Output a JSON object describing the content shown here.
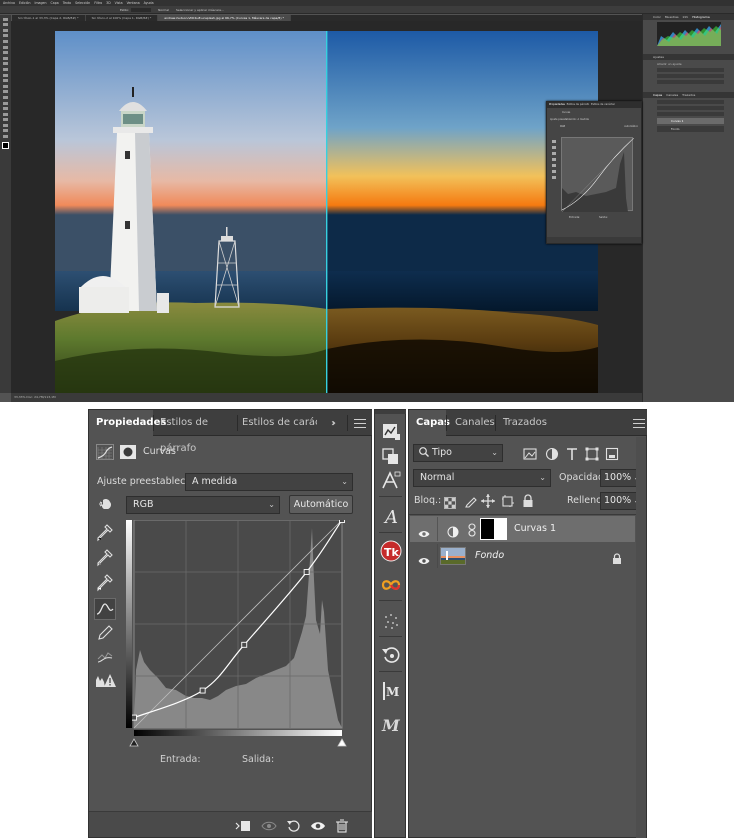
{
  "top": {
    "menu": [
      "Archivo",
      "Edición",
      "Imagen",
      "Capa",
      "Texto",
      "Selección",
      "Filtro",
      "3D",
      "Vista",
      "Ventana",
      "Ayuda"
    ],
    "options": {
      "style_label": "Estilo:",
      "style_value": "Normal",
      "mask_button": "Seleccionar y aplicar máscara..."
    },
    "doc_tabs": [
      "Sin título-1 al 33,3% (Capa 2, RGB/8#) *",
      "Sin título-2 al 100% (Capa 1, RGB/8#) *",
      "andrew-hudson-VNCbuE-unsplash.jpg al 66,7% (Curvas 1, Máscara de capa/8) *"
    ],
    "status": "33,33%   Doc: 24,7M/113,1M",
    "right_panels": {
      "top_tabs": [
        "Color",
        "Muestras",
        "Info",
        "Histograma"
      ],
      "adjust_tabs": [
        "Ajustes"
      ],
      "adjust_label": "Añadir un ajuste",
      "layer_tabs": [
        "Capas",
        "Canales",
        "Trazados"
      ],
      "layers": [
        "Curvas 1",
        "Fondo"
      ]
    },
    "float_props": {
      "tabs": [
        "Propiedades",
        "Estilos de párrafo",
        "Estilos de carácter"
      ],
      "type": "Curvas",
      "preset_label": "Ajuste preestablecido:",
      "preset_value": "A medida",
      "channel": "RGB",
      "auto": "Automático",
      "entrada": "Entrada:",
      "salida": "Salida:"
    }
  },
  "properties": {
    "tabs": [
      "Propiedades",
      "Estilos de párrafo",
      "Estilos de carácter"
    ],
    "adjustment_type": "Curvas",
    "preset_label": "Ajuste preestablecido:",
    "preset_value": "A medida",
    "channel_value": "RGB",
    "auto_button": "Automático",
    "entrada_label": "Entrada:",
    "salida_label": "Salida:",
    "curve_points": [
      [
        0,
        0.05
      ],
      [
        0.33,
        0.18
      ],
      [
        0.53,
        0.4
      ],
      [
        0.83,
        0.75
      ],
      [
        1,
        1
      ]
    ]
  },
  "layers_panel": {
    "tabs": [
      "Capas",
      "Canales",
      "Trazados"
    ],
    "filter_value": "Tipo",
    "blend_mode": "Normal",
    "opacity_label": "Opacidad:",
    "opacity_value": "100%",
    "lock_label": "Bloq.:",
    "fill_label": "Relleno:",
    "fill_value": "100%",
    "layers": [
      {
        "name": "Curvas 1",
        "selected": true
      },
      {
        "name": "Fondo",
        "selected": false
      }
    ]
  },
  "colors": {
    "panel": "#535353",
    "tab_bar": "#3e3e3e",
    "dark": "#2b2b2b",
    "selected_row": "#6e6e6e",
    "guide_cyan": "#36d0e0"
  }
}
